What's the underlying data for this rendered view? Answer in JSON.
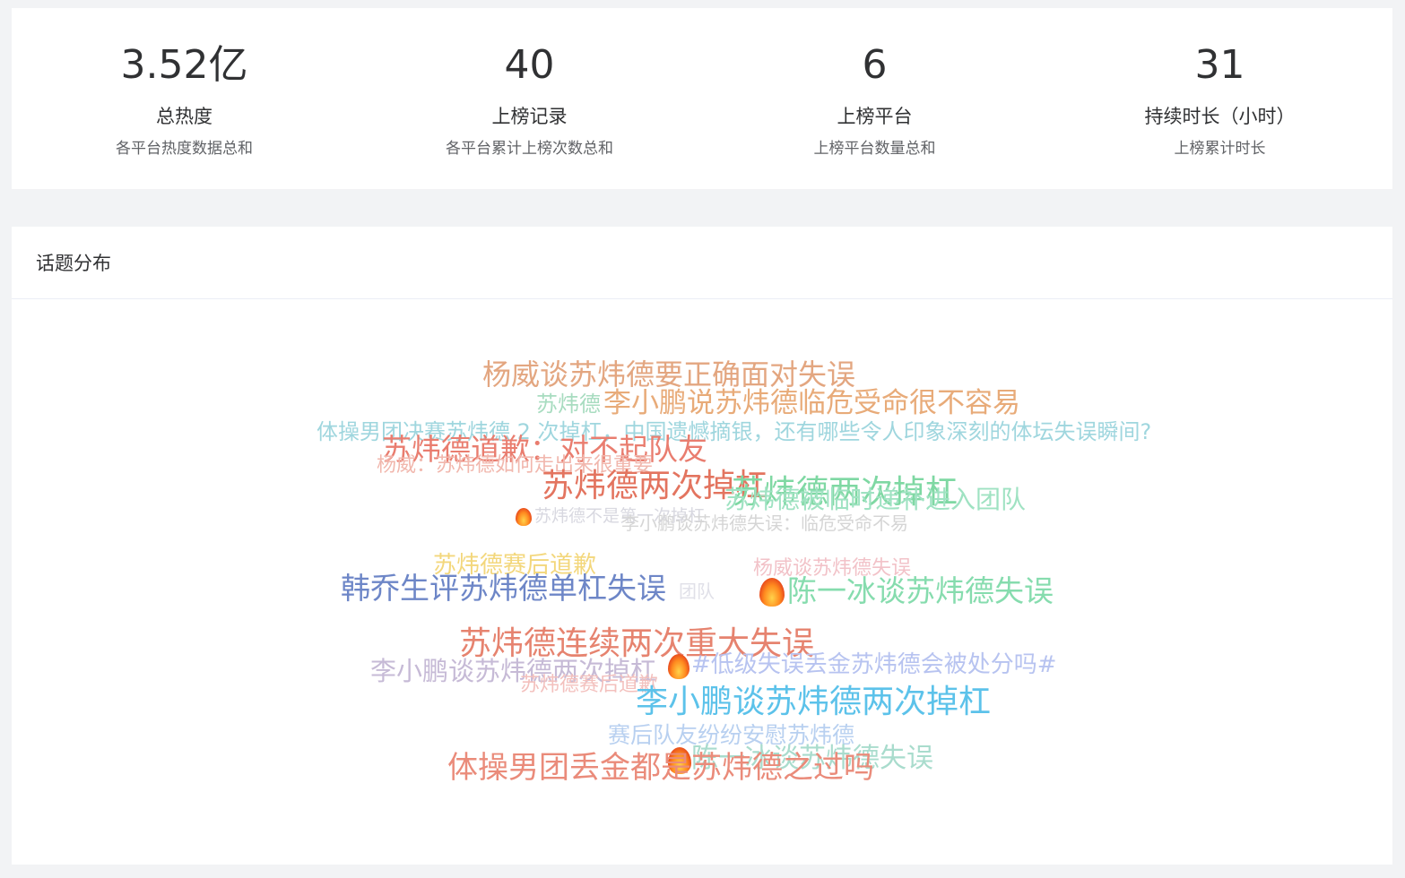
{
  "stats": [
    {
      "value": "3.52亿",
      "label": "总热度",
      "desc": "各平台热度数据总和"
    },
    {
      "value": "40",
      "label": "上榜记录",
      "desc": "各平台累计上榜次数总和"
    },
    {
      "value": "6",
      "label": "上榜平台",
      "desc": "上榜平台数量总和"
    },
    {
      "value": "31",
      "label": "持续时长（小时）",
      "desc": "上榜累计时长"
    }
  ],
  "topic_section": {
    "title": "话题分布"
  },
  "wordcloud": {
    "words": [
      {
        "text": "杨威谈苏炜德要正确面对失误",
        "color": "#e3a680"
      },
      {
        "text": "苏炜德",
        "color": "#a8dcc0"
      },
      {
        "text": "李小鹏说苏炜德临危受命很不容易",
        "color": "#e8ab79"
      },
      {
        "text": "体操男团决赛苏炜德 2 次掉杠，中国遗憾摘银，还有哪些令人印象深刻的体坛失误瞬间?",
        "color": "#9fd6de"
      },
      {
        "text": "苏炜德道歉：对不起队友",
        "color": "#e97d6f"
      },
      {
        "text": "杨威：苏炜德如何走出来很重要",
        "color": "#f1b7ad"
      },
      {
        "text": "苏炜德两次掉杠",
        "color": "#e3745f"
      },
      {
        "text": "苏炜德两次掉杠",
        "color": "#7fd8a3"
      },
      {
        "text": "苏炜德被临时递补进入团队",
        "color": "#9fe2c2"
      },
      {
        "text": "苏炜德不是第一次掉杠",
        "color": "#d8d8e0"
      },
      {
        "text": "李小鹏谈苏炜德失误：临危受命不易",
        "color": "#d5d5d5"
      },
      {
        "text": "苏炜德赛后道歉",
        "color": "#f3d77c"
      },
      {
        "text": "杨威谈苏炜德失误",
        "color": "#f2c2c8"
      },
      {
        "text": "韩乔生评苏炜德单杠失误",
        "color": "#6d86c7"
      },
      {
        "text": "团队",
        "color": "#e0e0e8"
      },
      {
        "text": "陈一冰谈苏炜德失误",
        "color": "#86dcae"
      },
      {
        "text": "苏炜德连续两次重大失误",
        "color": "#e6836f"
      },
      {
        "text": "李小鹏谈苏炜德两次掉杠",
        "color": "#c6bad6"
      },
      {
        "text": "#低级失误丢金苏炜德会被处分吗#",
        "color": "#b7c3f0"
      },
      {
        "text": "苏炜德赛后道歉",
        "color": "#f3c0bd"
      },
      {
        "text": "李小鹏谈苏炜德两次掉杠",
        "color": "#5cc2ea"
      },
      {
        "text": "赛后队友纷纷安慰苏炜德",
        "color": "#b8d0f0"
      },
      {
        "text": "陈一冰谈苏炜德失误",
        "color": "#a9dccd"
      },
      {
        "text": "体操男团丢金都是苏炜德之过吗",
        "color": "#ea8b7a"
      }
    ]
  }
}
